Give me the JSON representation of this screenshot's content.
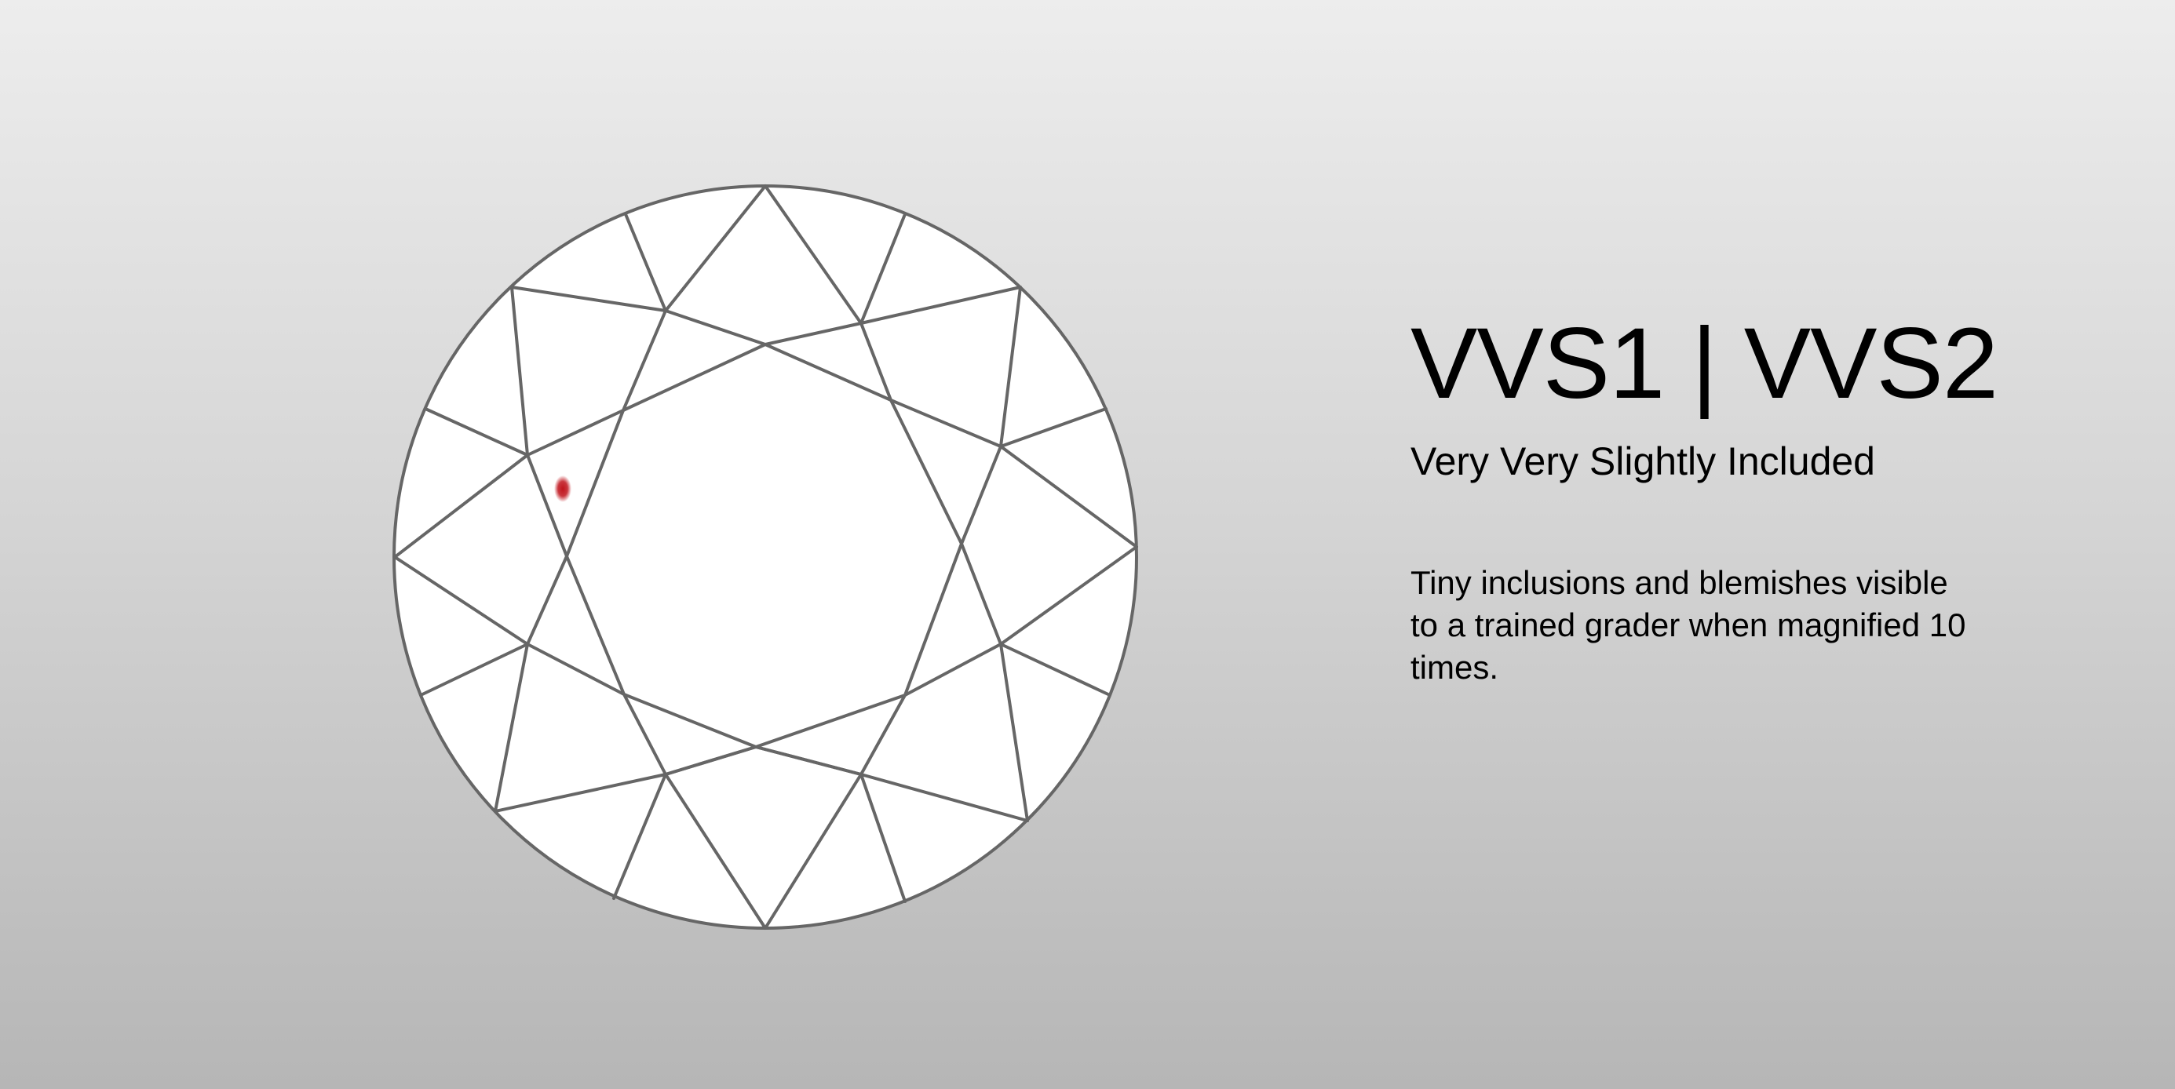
{
  "grade": {
    "title": "VVS1 | VVS2",
    "subtitle": "Very Very Slightly Included",
    "description": "Tiny inclusions and blemishes visible to a trained grader when magnified 10 times."
  },
  "diagram": {
    "facet_fill": "#ffffff",
    "facet_stroke": "#666666",
    "inclusion_color": "#c0141c"
  }
}
